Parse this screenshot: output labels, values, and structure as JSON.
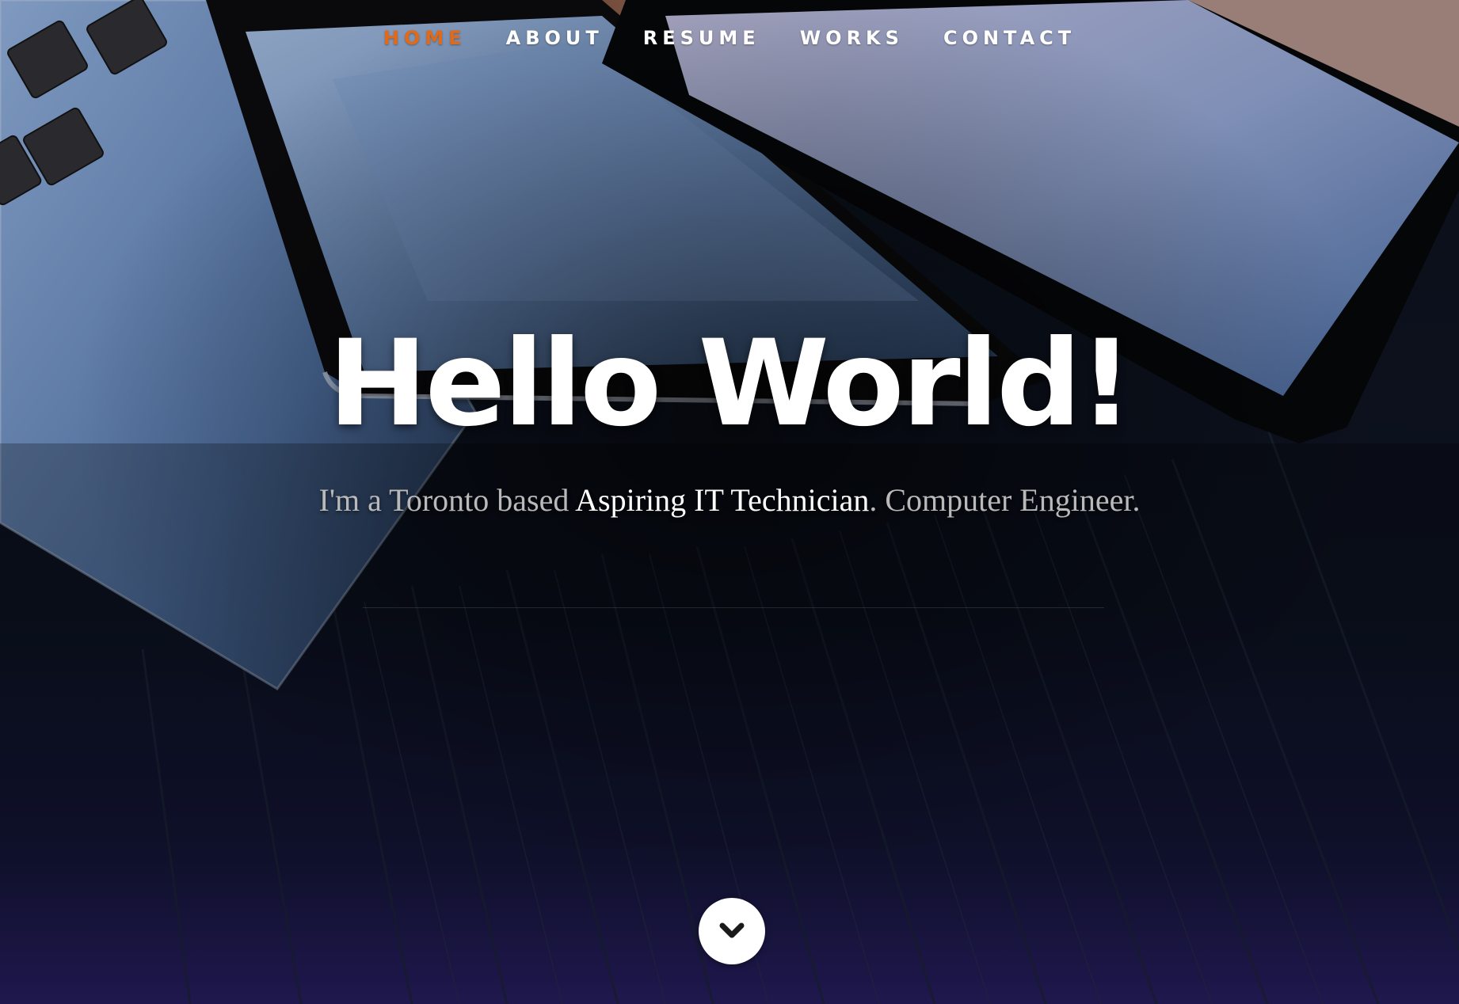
{
  "nav": {
    "items": [
      {
        "label": "HOME",
        "active": true
      },
      {
        "label": "ABOUT",
        "active": false
      },
      {
        "label": "RESUME",
        "active": false
      },
      {
        "label": "WORKS",
        "active": false
      },
      {
        "label": "CONTACT",
        "active": false
      }
    ]
  },
  "hero": {
    "headline": "Hello World!",
    "subline": {
      "prefix": "I'm a Toronto based ",
      "highlight": "Aspiring IT Technician",
      "suffix": ". Computer Engineer."
    },
    "scroll_icon": "chevron-down-icon"
  },
  "colors": {
    "accent": "#e06a1a",
    "text": "#ffffff",
    "muted_text": "#b9b9b9"
  }
}
